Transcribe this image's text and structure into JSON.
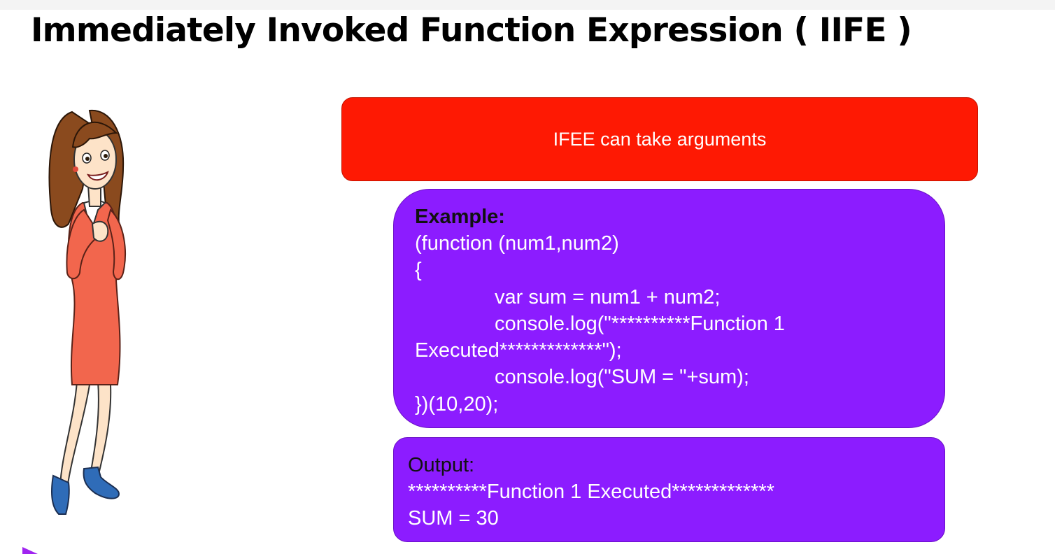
{
  "slide": {
    "title": "Immediately Invoked Function Expression ( IIFE )",
    "banner_text": "IFEE can take arguments",
    "colors": {
      "banner": "#fe1903",
      "code_panels": "#8c1cff",
      "dress": "#f2664d",
      "shoes": "#2f6cb8"
    },
    "illustration": "cartoon-woman-presenter"
  },
  "example": {
    "heading": "Example:",
    "lines": [
      "(function (num1,num2)",
      "{",
      "var sum = num1 + num2;",
      "console.log(\"**********Function 1",
      "Executed*************\");",
      "console.log(\"SUM = \"+sum);",
      "})(10,20);"
    ]
  },
  "output": {
    "heading": "Output:",
    "lines": [
      "**********Function 1 Executed*************",
      "SUM = 30"
    ]
  }
}
